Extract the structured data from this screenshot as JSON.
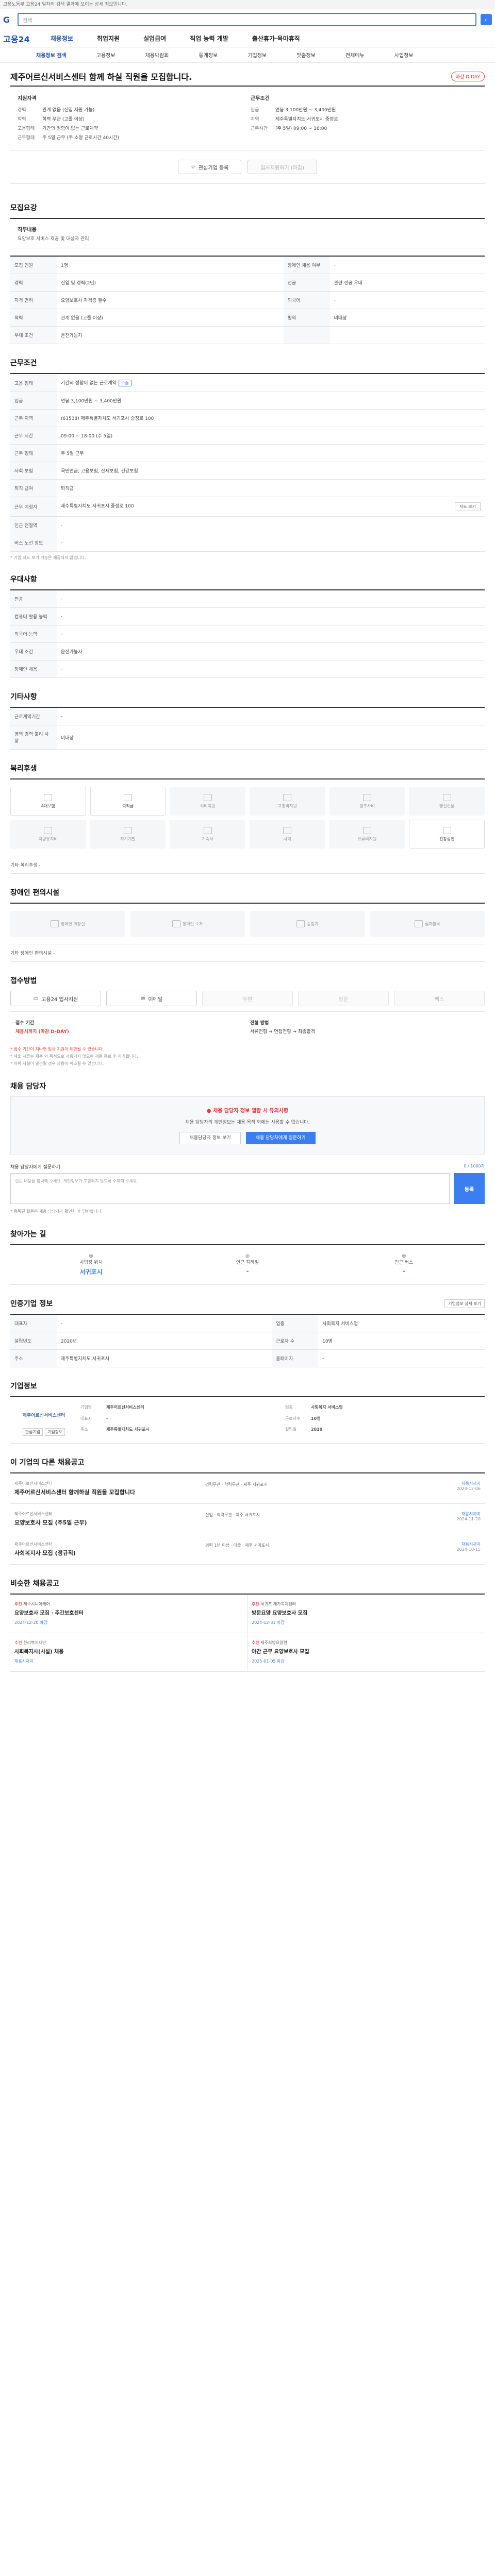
{
  "topbar": {
    "text": "고용노동부 고용24 일자리 검색 결과에 보이는 상세 정보입니다."
  },
  "search": {
    "placeholder": "검색"
  },
  "gnb": {
    "logo": "고용24",
    "menus": [
      "채용정보",
      "취업지원",
      "실업급여",
      "직업 능력 개발",
      "출산휴가·육아휴직"
    ]
  },
  "subnav": [
    "채용정보 검색",
    "고용정보",
    "채용박람회",
    "통계정보",
    "기업정보",
    "맞춤정보",
    "전체메뉴",
    "사업정보"
  ],
  "job": {
    "title": "제주어르신서비스센터 함께 하실 직원을 모집합니다.",
    "badge": "마감 D-DAY"
  },
  "summary": {
    "left_title": "지원자격",
    "left": [
      {
        "k": "경력",
        "v": "관계 없음 (신입 지원 가능)"
      },
      {
        "k": "학력",
        "v": "학력 무관 (고졸 이상)"
      },
      {
        "k": "고용형태",
        "v": "기간의 정함이 없는 근로계약"
      },
      {
        "k": "근무형태",
        "v": "주 5일 근무 (주 소정 근로시간 40시간)"
      }
    ],
    "right_title": "근무조건",
    "right": [
      {
        "k": "임금",
        "v": "연봉 3,100만원 ~ 3,400만원"
      },
      {
        "k": "지역",
        "v": "제주특별자치도 서귀포시 중정로"
      },
      {
        "k": "근무시간",
        "v": "(주 5일) 09:00 ~ 18:00"
      }
    ]
  },
  "actions": {
    "scrap": "관심기업 등록",
    "apply": "입사지원하기 (마감)"
  },
  "qualification": {
    "title": "모집요강",
    "desc_k": "직무내용",
    "desc_v": "요양보호 서비스 제공 및 대상자 관리",
    "rows": [
      [
        {
          "k": "모집 인원",
          "v": "1명"
        },
        {
          "k": "장애인 채용 여부",
          "v": "-"
        }
      ],
      [
        {
          "k": "경력",
          "v": "신입 및 경력(2년)"
        },
        {
          "k": "전공",
          "v": "관련 전공 우대"
        }
      ],
      [
        {
          "k": "자격 면허",
          "v": "요양보호사 자격증 필수"
        },
        {
          "k": "외국어",
          "v": "-"
        }
      ],
      [
        {
          "k": "학력",
          "v": "관계 없음 (고졸 이상)"
        },
        {
          "k": "병역",
          "v": "비대상"
        }
      ],
      [
        {
          "k": "우대 조건",
          "v": "운전가능자"
        },
        {
          "k": "",
          "v": ""
        }
      ]
    ]
  },
  "conditions": {
    "title": "근무조건",
    "rows": [
      {
        "k": "고용 형태",
        "v": "기간의 정함이 없는 근로계약",
        "chip": "수습"
      },
      {
        "k": "임금",
        "v": "연봉 3,100만원 ~ 3,400만원"
      },
      {
        "k": "근무 지역",
        "v": "(63538) 제주특별자치도 서귀포시 중정로 100"
      },
      {
        "k": "근무 시간",
        "v": "09:00 ~ 18:00 (주 5일)"
      },
      {
        "k": "근무 형태",
        "v": "주 5일 근무"
      },
      {
        "k": "사회 보험",
        "v": "국민연금, 고용보험, 산재보험, 건강보험"
      },
      {
        "k": "퇴직 급여",
        "v": "퇴직금"
      },
      {
        "k": "근무 예정지",
        "v": "제주특별자치도 서귀포시 중정로 100"
      },
      {
        "k": "인근 전철역",
        "v": "-"
      },
      {
        "k": "버스 노선 정보",
        "v": "-"
      }
    ],
    "note": "* 기업 지도 보기 기능은 제공되지 않습니다.",
    "map_btn": "지도 보기"
  },
  "skills": {
    "title": "우대사항",
    "rows": [
      {
        "k": "전공",
        "v": "-"
      },
      {
        "k": "컴퓨터 활용 능력",
        "v": "-"
      },
      {
        "k": "외국어 능력",
        "v": "-"
      },
      {
        "k": "우대 조건",
        "v": "운전가능자"
      },
      {
        "k": "장애인 채용",
        "v": "-"
      }
    ]
  },
  "other": {
    "title": "기타사항",
    "rows": [
      {
        "k": "근로계약기간",
        "v": "-"
      },
      {
        "k": "병역 경력 불리 사항",
        "v": "비대상"
      }
    ]
  },
  "welfare": {
    "title": "복리후생",
    "items": [
      "4대보험",
      "퇴직금",
      "식비지원",
      "교통비지원",
      "경조사비",
      "명절선물",
      "차량유지비",
      "자기계발",
      "기숙사",
      "사택",
      "유류비지원",
      "건강검진"
    ],
    "extra_k": "기타 복리후생",
    "extra_v": "-"
  },
  "disability": {
    "title": "장애인 편의시설",
    "items": [
      "장애인 화장실",
      "장애인 주차",
      "승강기",
      "점자블록"
    ],
    "extra": "기타 장애인 편의시설 -"
  },
  "apply": {
    "title": "접수방법",
    "methods": [
      "고용24 입사지원",
      "이메일",
      "우편",
      "방문",
      "팩스"
    ],
    "period_k": "접수 기간",
    "period_v": "채용시까지 (마감 D-DAY)",
    "process_k": "전형 방법",
    "process_v": "서류전형 → 면접전형 → 최종합격",
    "notes": [
      "* 접수 기간이 지나면 입사 지원이 제한될 수 있습니다.",
      "* 제출 서류는 채용 외 목적으로 사용되지 않으며 채용 종료 후 파기됩니다.",
      "* 허위 사실이 발견될 경우 채용이 취소될 수 있습니다."
    ]
  },
  "qa": {
    "title": "채용 담당자",
    "warn": "채용 담당자 정보 열람 시 유의사항",
    "desc": "채용 담당자의 개인정보는 채용 목적 외에는 사용할 수 없습니다.",
    "btn1": "채용담당자 정보 보기",
    "btn2": "채용 담당자에게 질문하기",
    "ask_title": "채용 담당자에게 질문하기",
    "ask_count": "0 / 1000자",
    "ask_placeholder": "질문 내용을 입력해 주세요. 개인정보가 포함되지 않도록 주의해 주세요.",
    "ask_btn": "등록",
    "notes": "* 등록된 질문은 채용 담당자가 확인한 후 답변합니다."
  },
  "location": {
    "title": "찾아가는 길",
    "items": [
      {
        "k": "사업장 위치",
        "v": "서귀포시"
      },
      {
        "k": "인근 지하철",
        "v": "-"
      },
      {
        "k": "인근 버스",
        "v": "-"
      }
    ]
  },
  "company_info": {
    "title": "인증기업 정보",
    "more": "기업정보 상세 보기",
    "rows": [
      [
        {
          "k": "대표자",
          "v": "-"
        },
        {
          "k": "업종",
          "v": "사회복지 서비스업"
        }
      ],
      [
        {
          "k": "설립년도",
          "v": "2020년"
        },
        {
          "k": "근로자 수",
          "v": "10명"
        }
      ],
      [
        {
          "k": "주소",
          "v": "제주특별자치도 서귀포시"
        },
        {
          "k": "홈페이지",
          "v": "-"
        }
      ]
    ]
  },
  "company": {
    "title": "기업정보",
    "logo": "제주어르신서비스센터",
    "b1": "관심기업",
    "b2": "기업정보",
    "info": [
      {
        "k": "기업명",
        "v": "제주어르신서비스센터"
      },
      {
        "k": "업종",
        "v": "사회복지 서비스업"
      },
      {
        "k": "대표자",
        "v": "-"
      },
      {
        "k": "근로자수",
        "v": "10명"
      },
      {
        "k": "주소",
        "v": "제주특별자치도 서귀포시"
      },
      {
        "k": "설립일",
        "v": "2020"
      }
    ]
  },
  "similar": {
    "title": "이 기업의 다른 채용공고",
    "items": [
      {
        "co": "제주어르신서비스센터",
        "t": "제주어르신서비스센터 함께하실 직원을 모집합니다",
        "m": "경력무관 · 학력무관 · 제주 서귀포시",
        "r": "채용시까지",
        "d": "2024-12-06"
      },
      {
        "co": "제주어르신서비스센터",
        "t": "요양보호사 모집 (주5일 근무)",
        "m": "신입 · 학력무관 · 제주 서귀포시",
        "r": "채용시까지",
        "d": "2024-11-20"
      },
      {
        "co": "제주어르신서비스센터",
        "t": "사회복지사 모집 (정규직)",
        "m": "경력 1년 이상 · 대졸 · 제주 서귀포시",
        "r": "채용시까지",
        "d": "2024-10-15"
      }
    ]
  },
  "ads": {
    "title": "비슷한 채용공고",
    "items": [
      {
        "tag": "추천",
        "co": "제주시니어케어",
        "t": "요양보호사 모집 · 주간보호센터",
        "dt": "2024-12-20 마감"
      },
      {
        "tag": "추천",
        "co": "서귀포 재가복지센터",
        "t": "방문요양 요양보호사 모집",
        "dt": "2024-12-31 마감"
      },
      {
        "tag": "추천",
        "co": "한라복지재단",
        "t": "사회복지사(시설) 채용",
        "dt": "채용시까지"
      },
      {
        "tag": "추천",
        "co": "제주희망요양원",
        "t": "야간 근무 요양보호사 모집",
        "dt": "2025-01-05 마감"
      }
    ]
  }
}
